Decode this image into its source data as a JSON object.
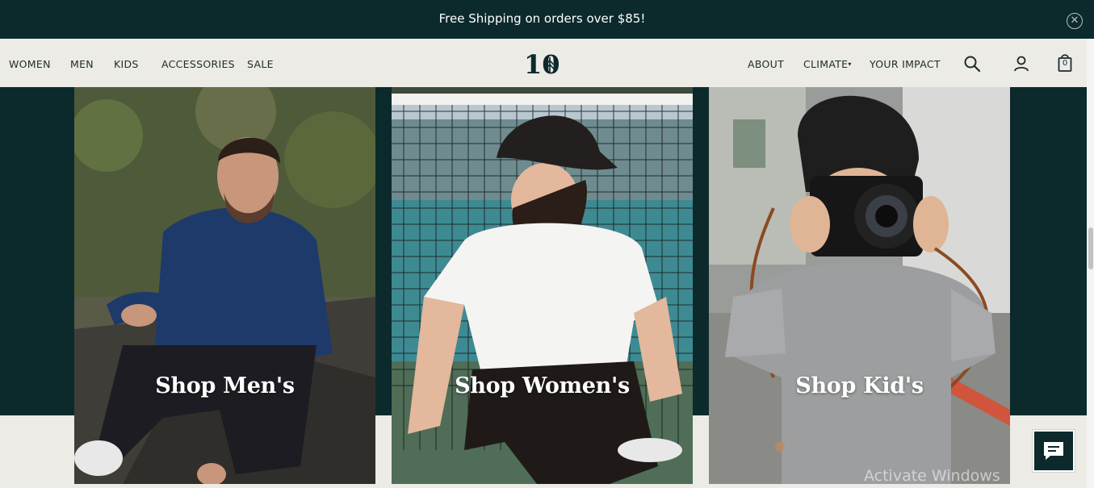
{
  "announcement": {
    "text": "Free Shipping on orders over $85!",
    "close_icon": "close-circle-icon"
  },
  "nav": {
    "left": [
      "WOMEN",
      "MEN",
      "KIDS",
      "ACCESSORIES",
      "SALE"
    ],
    "right": [
      "ABOUT",
      "CLIMATE",
      "YOUR IMPACT"
    ],
    "climate_caret": "▾",
    "logo_text": "10",
    "icons": [
      "search-icon",
      "account-icon",
      "cart-icon"
    ],
    "cart_count": "0"
  },
  "cards": [
    {
      "label": "Shop Men's"
    },
    {
      "label": "Shop Women's"
    },
    {
      "label": "Shop Kid's"
    }
  ],
  "watermark": "Activate Windows",
  "colors": {
    "brand_dark": "#0c2a2c",
    "nav_bg": "#ecebe6",
    "text": "#1d2b2c"
  }
}
